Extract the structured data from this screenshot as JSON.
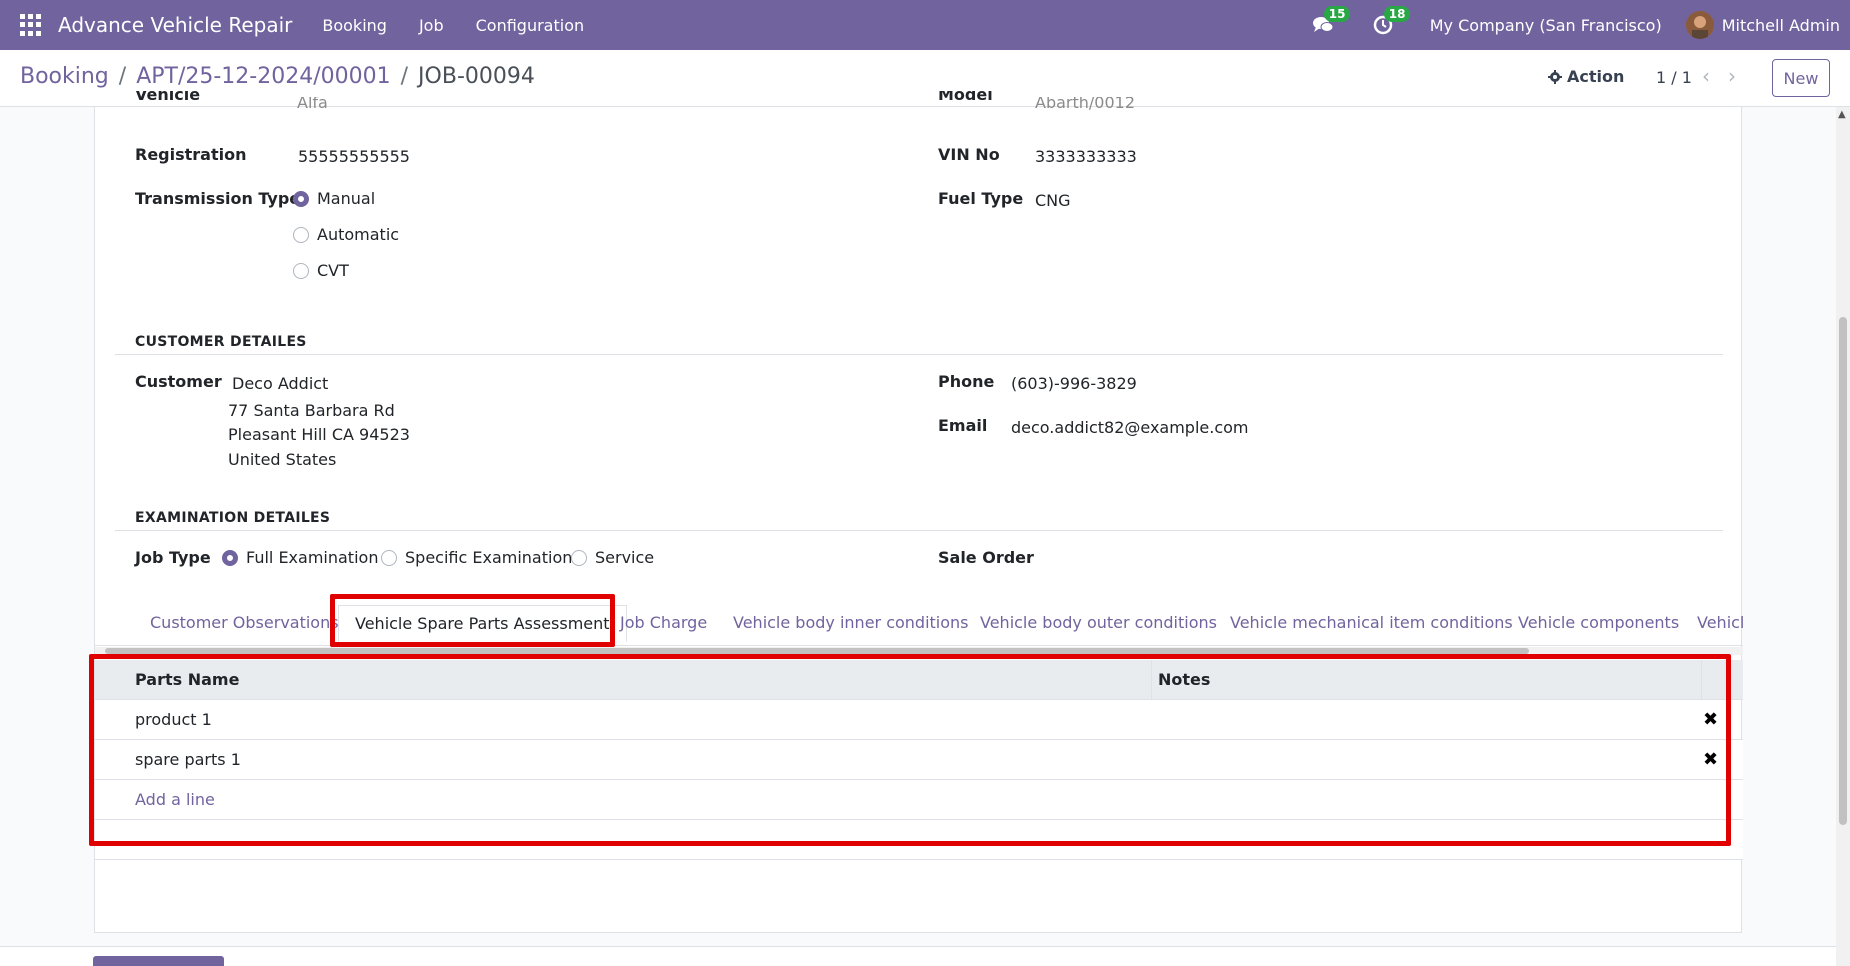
{
  "navbar": {
    "brand": "Advance Vehicle Repair",
    "menu": [
      "Booking",
      "Job",
      "Configuration"
    ],
    "messages_count": "15",
    "activities_count": "18",
    "company": "My Company (San Francisco)",
    "user": "Mitchell Admin"
  },
  "control": {
    "breadcrumb": [
      "Booking",
      "APT/25-12-2024/00001",
      "JOB-00094"
    ],
    "breadcrumb_sep": "/",
    "action_label": "Action",
    "pager": "1 / 1",
    "new_label": "New"
  },
  "vehicle": {
    "vehicle_label": "Vehicle",
    "vehicle_value": "Alfa",
    "model_label": "Model",
    "model_value": "Abarth/0012",
    "registration_label": "Registration",
    "registration_value": "55555555555",
    "vin_label": "VIN No",
    "vin_value": "3333333333",
    "transmission_label": "Transmission Type",
    "transmission_options": [
      "Manual",
      "Automatic",
      "CVT"
    ],
    "transmission_selected": "Manual",
    "fuel_label": "Fuel Type",
    "fuel_value": "CNG"
  },
  "customer": {
    "section_title": "CUSTOMER DETAILES",
    "customer_label": "Customer",
    "name": "Deco Addict",
    "address_line1": "77 Santa Barbara Rd",
    "address_line2": "Pleasant Hill CA 94523",
    "address_line3": "United States",
    "phone_label": "Phone",
    "phone_value": "(603)-996-3829",
    "email_label": "Email",
    "email_value": "deco.addict82@example.com"
  },
  "examination": {
    "section_title": "EXAMINATION DETAILES",
    "job_type_label": "Job Type",
    "job_type_options": [
      "Full Examination",
      "Specific Examination",
      "Service"
    ],
    "job_type_selected": "Full Examination",
    "sale_order_label": "Sale Order"
  },
  "tabs": [
    "Customer Observations",
    "Vehicle Spare Parts Assessment",
    "Job Charge",
    "Vehicle body inner conditions",
    "Vehicle body outer conditions",
    "Vehicle mechanical item conditions",
    "Vehicle components",
    "Vehicl"
  ],
  "active_tab": "Vehicle Spare Parts Assessment",
  "parts_table": {
    "columns": [
      "Parts Name",
      "Notes"
    ],
    "rows": [
      {
        "parts_name": "product 1",
        "notes": ""
      },
      {
        "parts_name": "spare parts 1",
        "notes": ""
      }
    ],
    "add_line": "Add a line"
  },
  "colors": {
    "brand": "#71639e",
    "highlight": "#e00000",
    "badge": "#28a745"
  }
}
